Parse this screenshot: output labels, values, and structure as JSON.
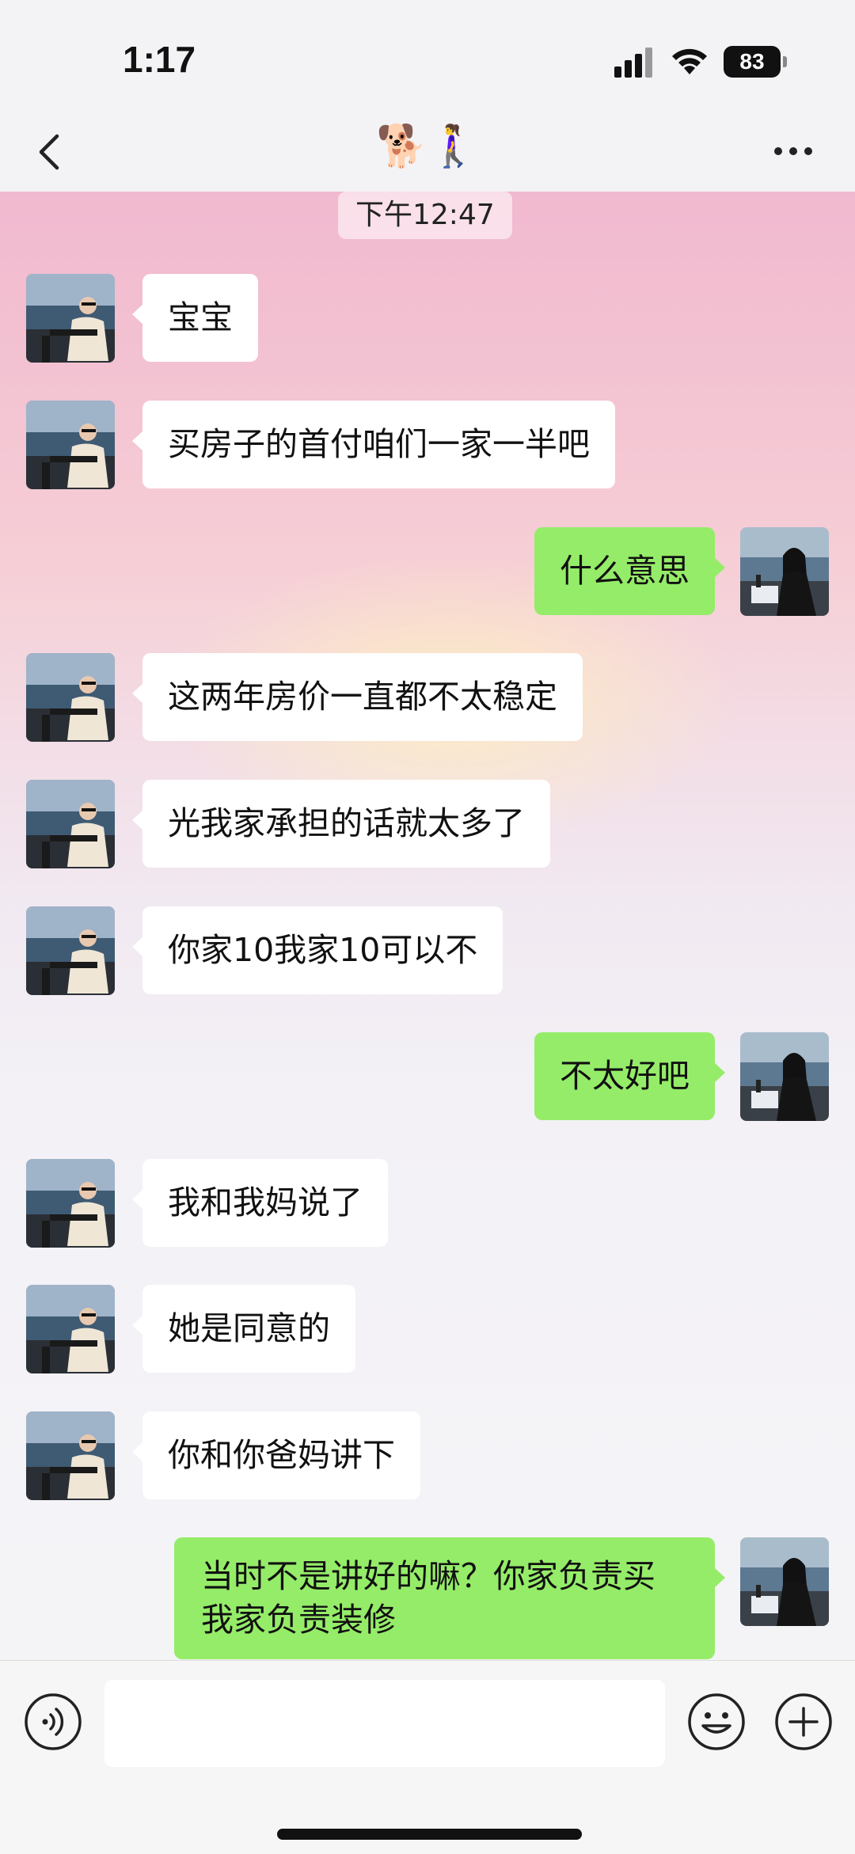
{
  "status": {
    "time": "1:17",
    "battery": "83",
    "icons": [
      "signal-icon",
      "wifi-icon",
      "battery-icon"
    ]
  },
  "nav": {
    "title": "🐕🚶‍♀️",
    "back_icon": "back-icon",
    "more_icon": "more-icon"
  },
  "chat": {
    "timestamp": "下午12:47",
    "messages": [
      {
        "side": "left",
        "text": "宝宝"
      },
      {
        "side": "left",
        "text": "买房子的首付咱们一家一半吧"
      },
      {
        "side": "right",
        "text": "什么意思"
      },
      {
        "side": "left",
        "text": "这两年房价一直都不太稳定"
      },
      {
        "side": "left",
        "text": "光我家承担的话就太多了"
      },
      {
        "side": "left",
        "text": "你家10我家10可以不"
      },
      {
        "side": "right",
        "text": "不太好吧"
      },
      {
        "side": "left",
        "text": "我和我妈说了"
      },
      {
        "side": "left",
        "text": "她是同意的"
      },
      {
        "side": "left",
        "text": "你和你爸妈讲下"
      },
      {
        "side": "right",
        "text": "当时不是讲好的嘛？你家负责买 我家负责装修"
      }
    ]
  },
  "input": {
    "value": "",
    "icons": [
      "voice-icon",
      "emoji-icon",
      "plus-icon"
    ]
  },
  "colors": {
    "sent_bubble": "#95ec69",
    "received_bubble": "#ffffff"
  }
}
